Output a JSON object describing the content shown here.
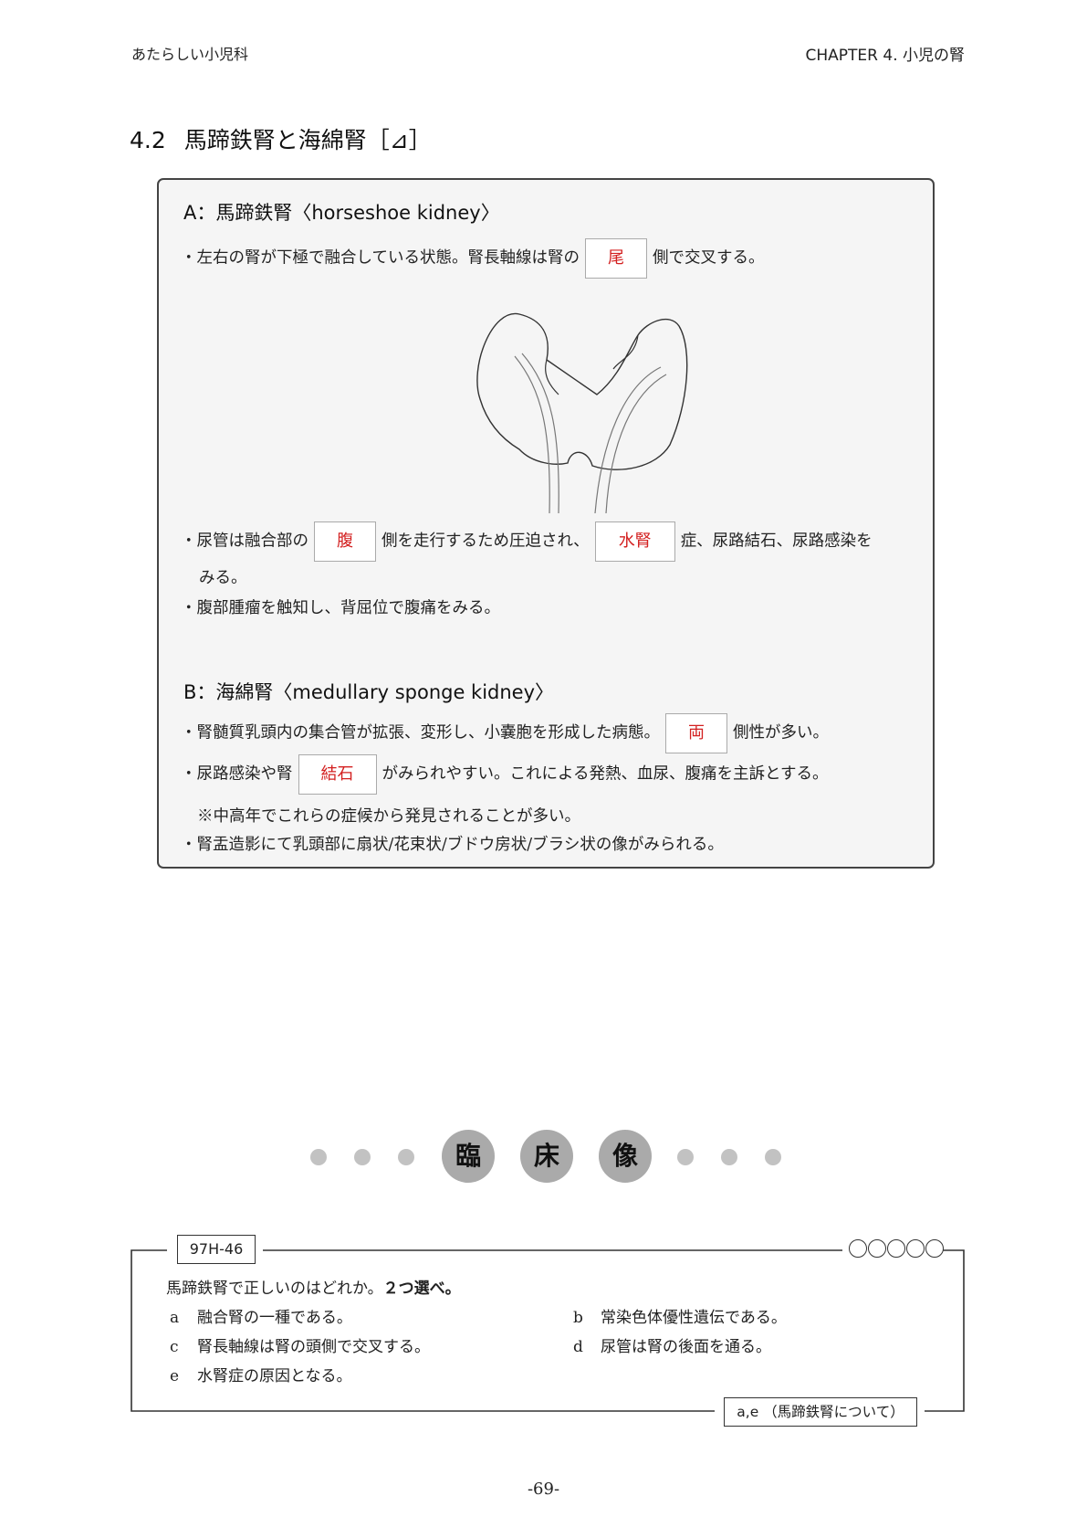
{
  "header": {
    "book_title": "あたらしい小児科",
    "chapter": "CHAPTER 4. 小児の腎"
  },
  "section": {
    "number": "4.2",
    "title": "馬蹄鉄腎と海綿腎［⊿］"
  },
  "topic_a": {
    "heading": "A：馬蹄鉄腎〈horseshoe kidney〉",
    "line1_before": "・左右の腎が下極で融合している状態。腎長軸線は腎の",
    "line1_blank": "尾",
    "line1_after": "側で交叉する。",
    "line2_before": "・尿管は融合部の",
    "line2_blank1": "腹",
    "line2_mid": "側を走行するため圧迫され、",
    "line2_blank2": "水腎",
    "line2_after": "症、尿路結石、尿路感染を",
    "line2_cont": "みる。",
    "line3": "・腹部腫瘤を触知し、背屈位で腹痛をみる。"
  },
  "topic_b": {
    "heading": "B：海綿腎〈medullary sponge kidney〉",
    "line1_before": "・腎髄質乳頭内の集合管が拡張、変形し、小嚢胞を形成した病態。",
    "line1_blank": "両",
    "line1_after": "側性が多い。",
    "line2_before": "・尿路感染や腎",
    "line2_blank": "結石",
    "line2_after": "がみられやすい。これによる発熱、血尿、腹痛を主訴とする。",
    "line2_note": "※中高年でこれらの症候から発見されることが多い。",
    "line3": "・腎盂造影にて乳頭部に扇状/花束状/ブドウ房状/ブラシ状の像がみられる。"
  },
  "clinical": {
    "chars": [
      "臨",
      "床",
      "像"
    ]
  },
  "question": {
    "code": "97H-46",
    "stem": "馬蹄鉄腎で正しいのはどれか。",
    "stem_bold": "２つ選べ。",
    "options": [
      {
        "key": "a",
        "text": "融合腎の一種である。"
      },
      {
        "key": "b",
        "text": "常染色体優性遺伝である。"
      },
      {
        "key": "c",
        "text": "腎長軸線は腎の頭側で交叉する。"
      },
      {
        "key": "d",
        "text": "尿管は腎の後面を通る。"
      },
      {
        "key": "e",
        "text": "水腎症の原因となる。"
      }
    ],
    "answer": "a,e （馬蹄鉄腎について）"
  },
  "page_number": "-69-",
  "colors": {
    "blank_text": "#d32020",
    "box_bg": "#f5f5f5",
    "disc_bg": "#aaaaaa",
    "dot": "#c2c2c2"
  }
}
